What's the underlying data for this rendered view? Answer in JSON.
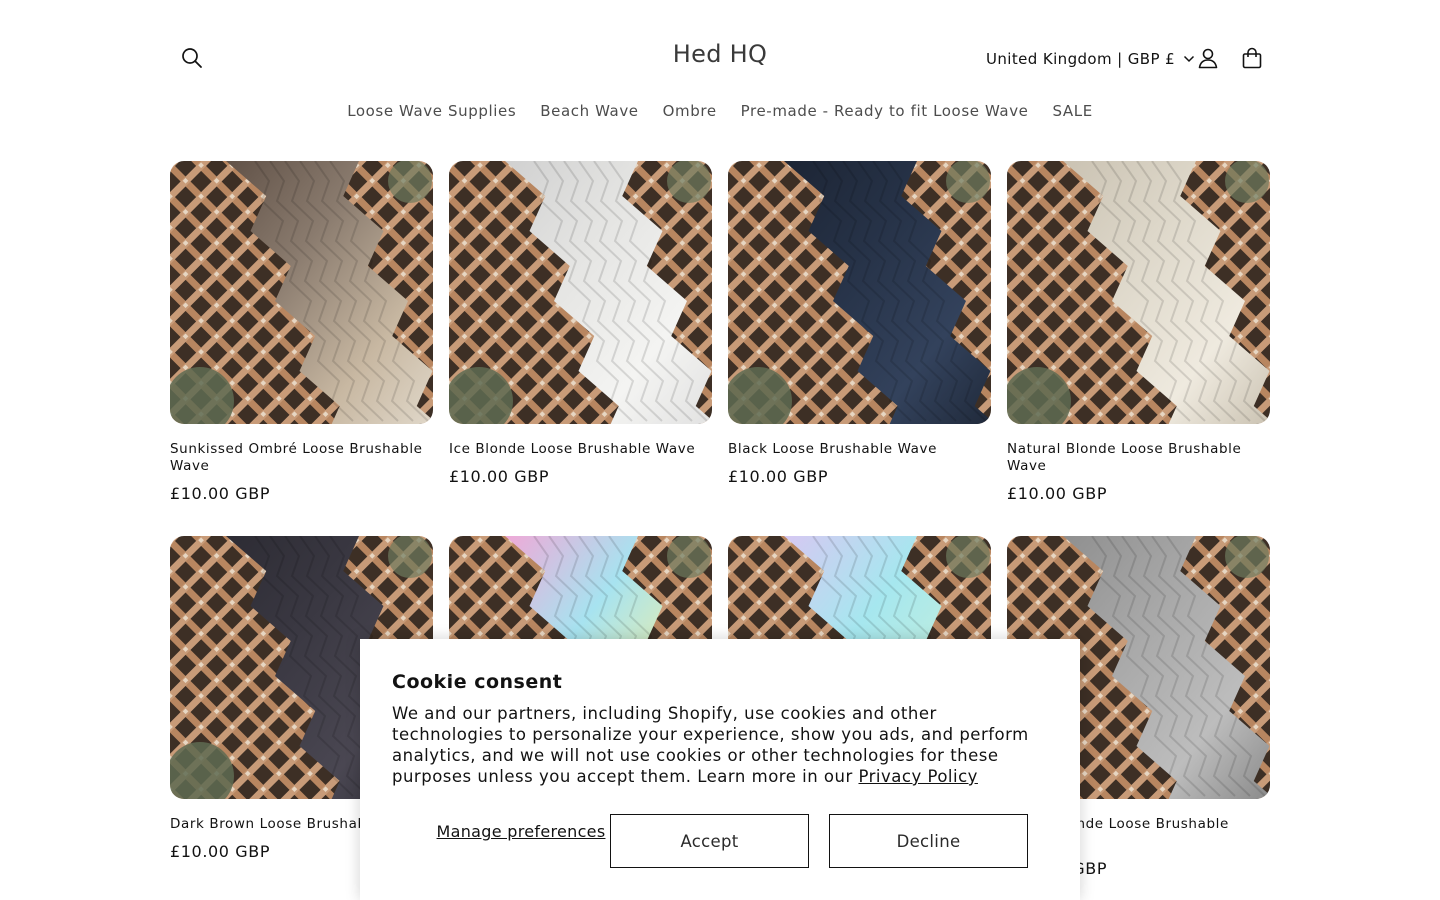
{
  "header": {
    "logo": "Hed HQ",
    "country_selector": "United Kingdom | GBP £",
    "icons": {
      "search": "search-icon",
      "account": "user-icon",
      "cart": "bag-icon",
      "dropdown": "chevron-down-icon"
    }
  },
  "nav": {
    "items": [
      "Loose Wave Supplies",
      "Beach Wave",
      "Ombre",
      "Pre-made - Ready to fit Loose Wave",
      "SALE"
    ]
  },
  "products": [
    {
      "title": "Sunkissed Ombré Loose Brushable Wave",
      "price": "£10.00 GBP",
      "hair_colors": [
        "#5e4f45",
        "#8a7b6e",
        "#c8b8a2",
        "#e8e2d6"
      ]
    },
    {
      "title": "Ice Blonde Loose Brushable Wave",
      "price": "£10.00 GBP",
      "hair_colors": [
        "#cfcfcf",
        "#e4e4e2",
        "#f4f4f2",
        "#dcdcdc"
      ]
    },
    {
      "title": "Black Loose Brushable Wave",
      "price": "£10.00 GBP",
      "hair_colors": [
        "#1c2433",
        "#263247",
        "#33425c",
        "#1a2230"
      ]
    },
    {
      "title": "Natural Blonde Loose Brushable Wave",
      "price": "£10.00 GBP",
      "hair_colors": [
        "#c9c1b1",
        "#ddd7c9",
        "#efeadf",
        "#bfb6a4"
      ]
    },
    {
      "title": "Dark Brown Loose Brushable Wave",
      "price": "£10.00 GBP",
      "hair_colors": [
        "#2c2b33",
        "#3a3842",
        "#4a4752",
        "#25242b"
      ]
    },
    {
      "title": "",
      "price": "",
      "hair_colors": [
        "#f3a6d6",
        "#a7e3f0",
        "#f4f0a0",
        "#d8a6f2"
      ]
    },
    {
      "title": "",
      "price": "",
      "hair_colors": [
        "#d9c6f2",
        "#a6e7ef",
        "#c7f0d8",
        "#b8c9f4"
      ]
    },
    {
      "title": "Silver Blonde Loose Brushable Wave",
      "price": "£10.00 GBP",
      "hair_colors": [
        "#8e8e8e",
        "#a7a7a7",
        "#bdbdbd",
        "#7a7a7a"
      ]
    }
  ],
  "cookie": {
    "title": "Cookie consent",
    "body": "We and our partners, including Shopify, use cookies and other technologies to personalize your experience, show you ads, and perform analytics, and we will not use cookies or other technologies for these purposes unless you accept them. Learn more in our ",
    "policy_link": "Privacy Policy",
    "manage": "Manage preferences",
    "accept": "Accept",
    "decline": "Decline"
  }
}
